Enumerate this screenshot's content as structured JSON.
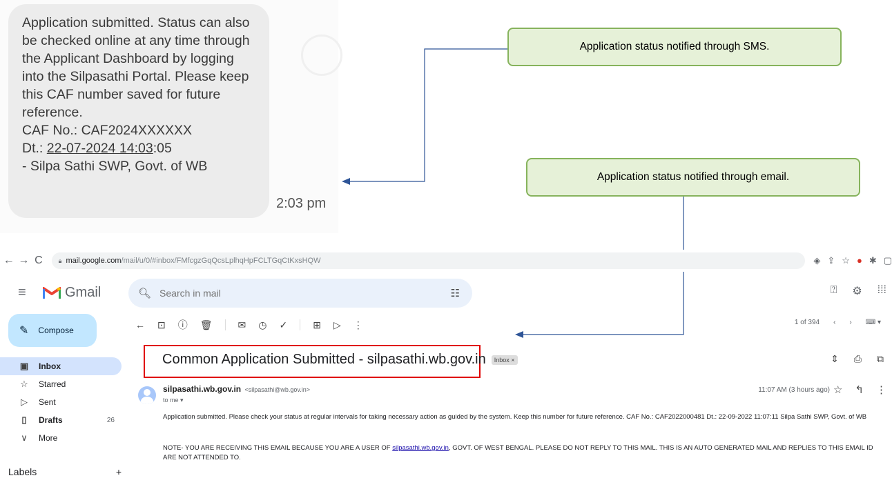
{
  "sms": {
    "message": "Application submitted. Status can also be checked online at any time through the Applicant Dashboard by logging into the Silpasathi Portal. Please keep this CAF number saved for future reference.",
    "caf_line": "CAF No.: CAF2024XXXXXX",
    "date_prefix": "Dt.: ",
    "date_value": "22-07-2024 14:03",
    "date_suffix": ":05",
    "signature": "- Silpa Sathi SWP, Govt. of WB",
    "time": "2:03 pm"
  },
  "callouts": {
    "sms": "Application status notified through SMS.",
    "email": "Application status notified through email."
  },
  "browser": {
    "url_host": "mail.google.com",
    "url_path": "/mail/u/0/#inbox/FMfcgzGqQcsLplhqHpFCLTGqCtKxsHQW"
  },
  "gmail": {
    "app_name": "Gmail",
    "search_placeholder": "Search in mail",
    "compose_label": "Compose",
    "sidebar": [
      {
        "label": "Inbox",
        "icon": "inbox-icon",
        "count": ""
      },
      {
        "label": "Starred",
        "icon": "star-icon",
        "count": ""
      },
      {
        "label": "Sent",
        "icon": "send-icon",
        "count": ""
      },
      {
        "label": "Drafts",
        "icon": "draft-icon",
        "count": "26"
      },
      {
        "label": "More",
        "icon": "chevron-down-icon",
        "count": ""
      }
    ],
    "labels_heading": "Labels",
    "labels_add": "+",
    "pager": "1 of 394"
  },
  "email": {
    "subject": "Common Application Submitted - silpasathi.wb.gov.in",
    "tag": "Inbox ×",
    "sender_name": "silpasathi.wb.gov.in",
    "sender_address": "<silpasathi@wb.gov.in>",
    "to": "to me ▾",
    "time": "11:07 AM (3 hours ago)",
    "body": "Application submitted. Please check your status at regular intervals for taking necessary action as guided by the system. Keep this number for future reference. CAF No.: CAF2022000481 Dt.: 22-09-2022 11:07:11 Silpa Sathi SWP, Govt. of WB",
    "note_prefix": "NOTE- YOU ARE RECEIVING THIS EMAIL BECAUSE YOU ARE A USER OF ",
    "note_link": "silpasathi.wb.gov.in",
    "note_suffix": ", GOVT. OF WEST BENGAL. PLEASE DO NOT REPLY TO THIS MAIL. THIS IS AN AUTO GENERATED MAIL AND REPLIES TO THIS EMAIL ID ARE NOT ATTENDED TO."
  },
  "colors": {
    "callout_fill": "#e6f1d8",
    "callout_border": "#86b35c",
    "arrow": "#2f5597",
    "highlight": "#e00000",
    "compose": "#c2e7ff",
    "inbox_active": "#d3e3fd"
  }
}
